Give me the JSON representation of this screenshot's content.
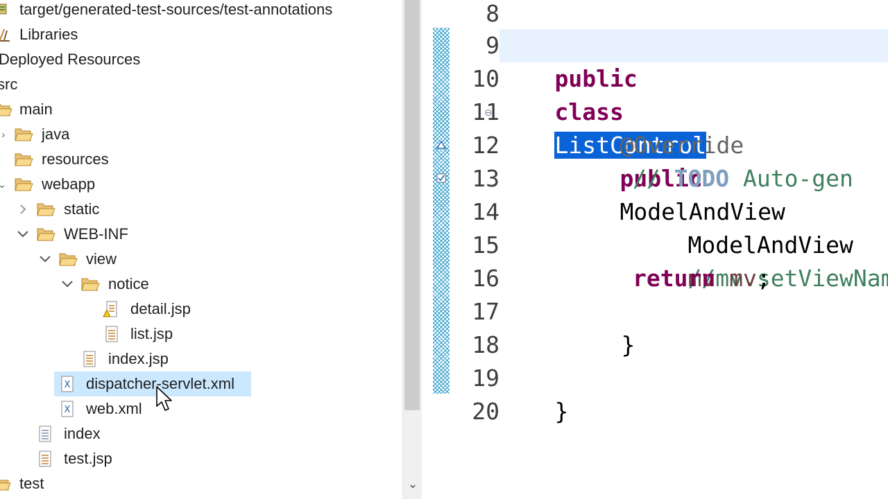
{
  "explorer": {
    "items": [
      {
        "label": "target/generated-test-sources/test-annotations",
        "icon": "source-folder-icon"
      },
      {
        "label": "Libraries",
        "icon": "libraries-icon"
      },
      {
        "label": "Deployed Resources",
        "icon": "none"
      },
      {
        "label": "src",
        "icon": "none"
      },
      {
        "label": "main",
        "icon": "folder-open-icon"
      },
      {
        "label": "java",
        "icon": "folder-open-icon"
      },
      {
        "label": "resources",
        "icon": "folder-open-icon"
      },
      {
        "label": "webapp",
        "icon": "folder-open-icon"
      },
      {
        "label": "static",
        "icon": "folder-open-icon"
      },
      {
        "label": "WEB-INF",
        "icon": "folder-open-icon"
      },
      {
        "label": "view",
        "icon": "folder-open-icon"
      },
      {
        "label": "notice",
        "icon": "folder-open-icon"
      },
      {
        "label": "detail.jsp",
        "icon": "jsp-file-warning-icon"
      },
      {
        "label": "list.jsp",
        "icon": "jsp-file-icon"
      },
      {
        "label": "index.jsp",
        "icon": "jsp-file-icon"
      },
      {
        "label": "dispatcher-servlet.xml",
        "icon": "xml-file-icon",
        "selected": true
      },
      {
        "label": "web.xml",
        "icon": "xml-file-icon"
      },
      {
        "label": "index",
        "icon": "text-file-icon"
      },
      {
        "label": "test.jsp",
        "icon": "jsp-file-icon"
      },
      {
        "label": "test",
        "icon": "folder-open-icon"
      }
    ]
  },
  "editor": {
    "line_numbers": [
      "8",
      "9",
      "10",
      "11",
      "12",
      "13",
      "14",
      "15",
      "16",
      "17",
      "18",
      "19",
      "20"
    ],
    "code": {
      "l9_kw1": "public",
      "l9_kw2": "class",
      "l9_class": "ListControl",
      "l11_annotation": "@Override",
      "l12_kw": "public",
      "l12_rest": "ModelAndView",
      "l13_slashes": "// ",
      "l13_todo": "TODO",
      "l13_rest": " Auto-gen",
      "l14_type": "ModelAndView",
      "l14_var": "mv",
      "l15_comment": "//mv.setViewName",
      "l16_kw": "return",
      "l16_var": "mv",
      "l16_semi": ";",
      "l17_brace": "}",
      "l19_brace": "}"
    },
    "colors": {
      "keyword": "#7f0055",
      "comment": "#3f7f5f",
      "todo": "#7f9fbf",
      "annotation": "#646464",
      "local_variable": "#6a3e3e",
      "selection": "#0a63d6",
      "current_line": "#e8f2fe"
    }
  }
}
